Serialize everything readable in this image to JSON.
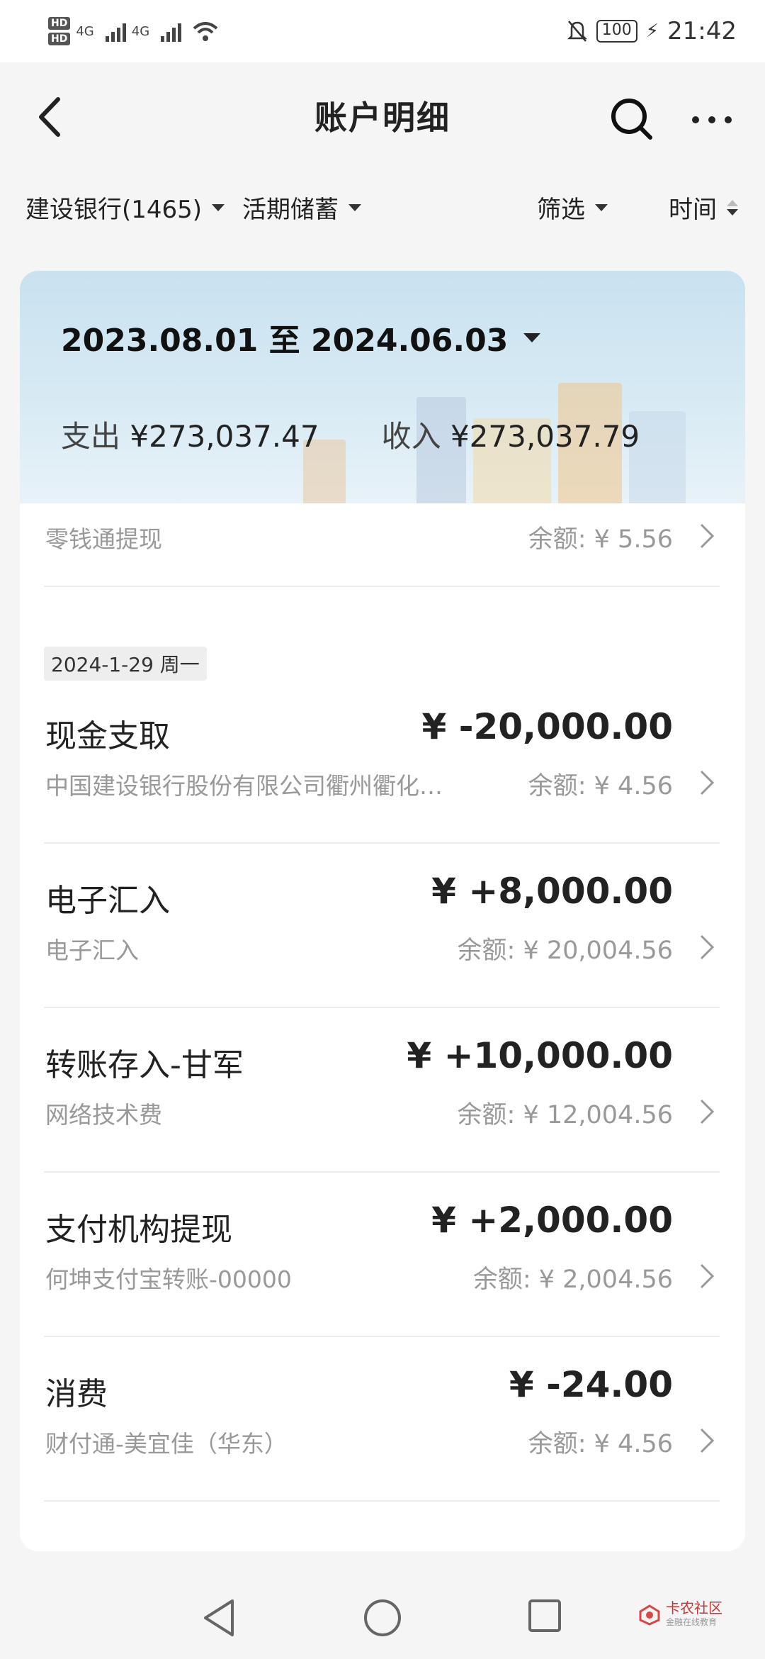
{
  "status_bar": {
    "hd1": "HD",
    "hd2": "HD",
    "net1": "4G",
    "net2": "4G",
    "battery": "100",
    "time": "21:42"
  },
  "nav": {
    "title": "账户明细"
  },
  "filters": {
    "account": "建设银行(1465)",
    "account_type": "活期储蓄",
    "filter": "筛选",
    "sort": "时间"
  },
  "summary": {
    "date_range": "2023.08.01 至 2024.06.03",
    "expense_label": "支出",
    "expense_value": "¥273,037.47",
    "income_label": "收入",
    "income_value": "¥273,037.79"
  },
  "partial_row": {
    "sub": "零钱通提现",
    "balance": "余额: ¥ 5.56"
  },
  "date_chip": "2024-1-29 周一",
  "transactions": [
    {
      "title": "现金支取",
      "amount": "¥ -20,000.00",
      "sub": "中国建设银行股份有限公司衢州衢化…",
      "balance": "余额: ¥ 4.56"
    },
    {
      "title": "电子汇入",
      "amount": "¥ +8,000.00",
      "sub": "电子汇入",
      "balance": "余额: ¥ 20,004.56"
    },
    {
      "title": "转账存入-甘军",
      "amount": "¥ +10,000.00",
      "sub": "网络技术费",
      "balance": "余额: ¥ 12,004.56"
    },
    {
      "title": "支付机构提现",
      "amount": "¥ +2,000.00",
      "sub": "何坤支付宝转账-00000",
      "balance": "余额: ¥ 2,004.56"
    },
    {
      "title": "消费",
      "amount": "¥ -24.00",
      "sub": "财付通-美宜佳（华东）",
      "balance": "余额: ¥ 4.56"
    }
  ],
  "watermark": {
    "name": "卡农社区",
    "tagline": "金融在线教育"
  }
}
